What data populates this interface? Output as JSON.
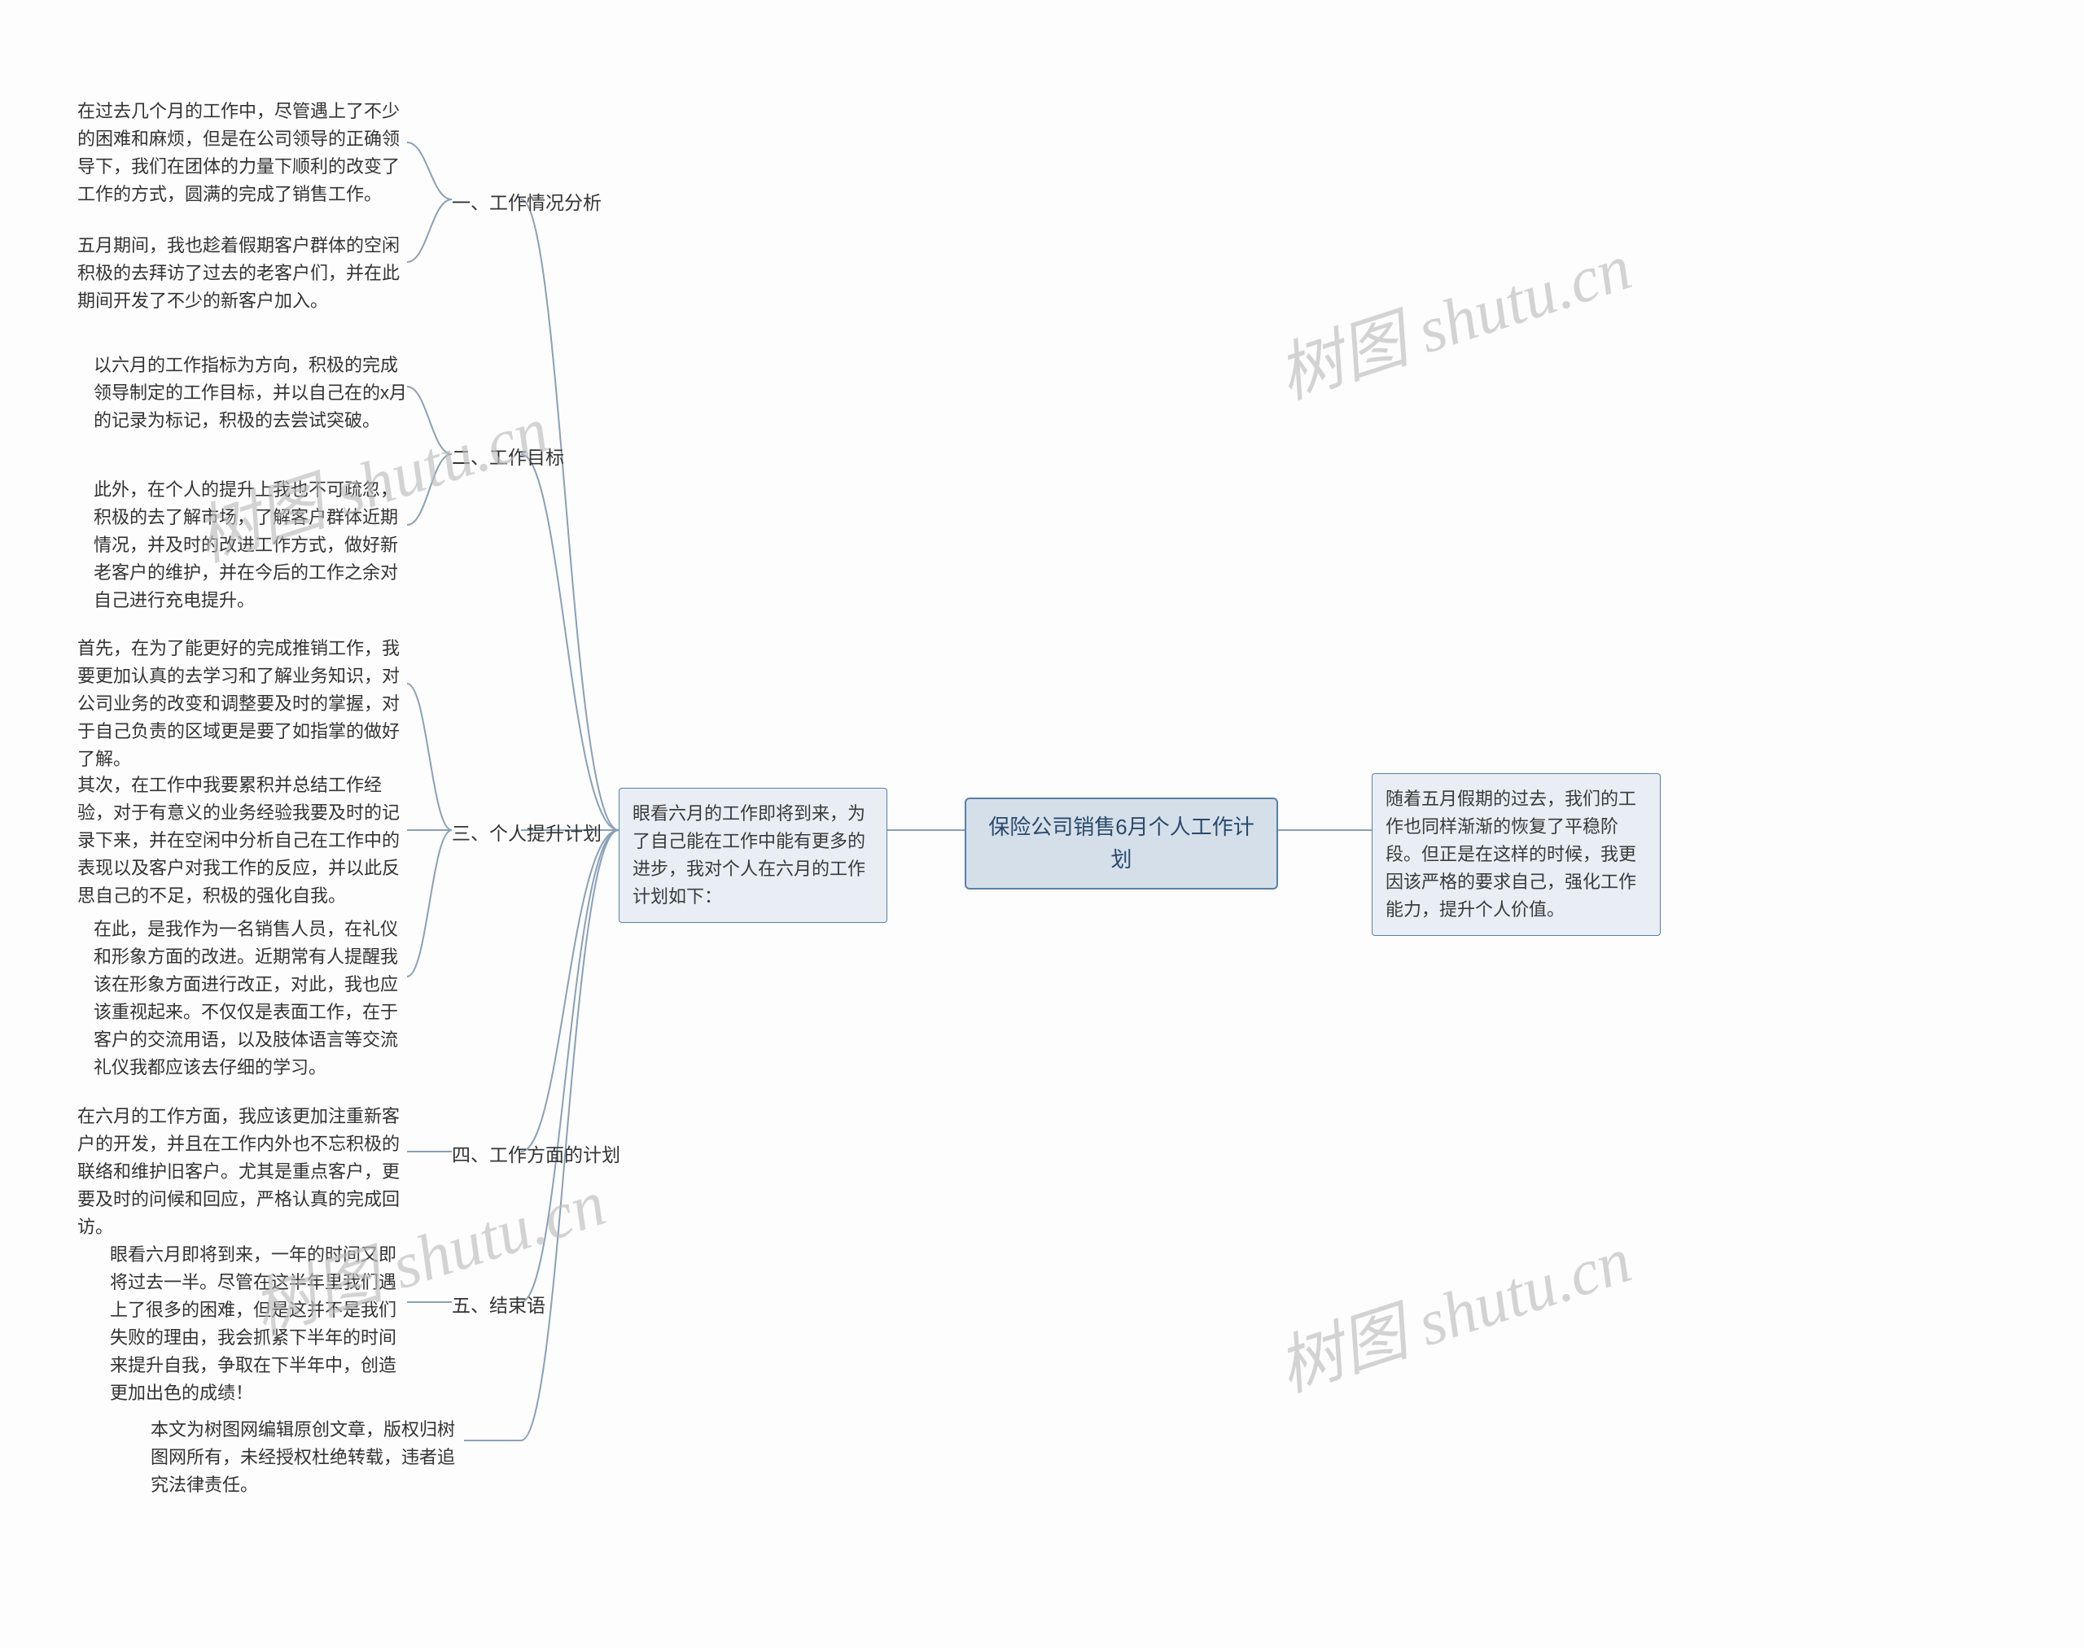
{
  "root": {
    "title": "保险公司销售6月个人工作计划"
  },
  "intro_left": "眼看六月的工作即将到来，为了自己能在工作中能有更多的进步，我对个人在六月的工作计划如下：",
  "intro_right": "随着五月假期的过去，我们的工作也同样渐渐的恢复了平稳阶段。但正是在这样的时候，我更因该严格的要求自己，强化工作能力，提升个人价值。",
  "branches": {
    "b1": {
      "label": "一、工作情况分析",
      "leaves": [
        "在过去几个月的工作中，尽管遇上了不少的困难和麻烦，但是在公司领导的正确领导下，我们在团体的力量下顺利的改变了工作的方式，圆满的完成了销售工作。",
        "五月期间，我也趁着假期客户群体的空闲积极的去拜访了过去的老客户们，并在此期间开发了不少的新客户加入。"
      ]
    },
    "b2": {
      "label": "二、工作目标",
      "leaves": [
        "以六月的工作指标为方向，积极的完成领导制定的工作目标，并以自己在的x月的记录为标记，积极的去尝试突破。",
        "此外，在个人的提升上我也不可疏忽，积极的去了解市场，了解客户群体近期情况，并及时的改进工作方式，做好新老客户的维护，并在今后的工作之余对自己进行充电提升。"
      ]
    },
    "b3": {
      "label": "三、个人提升计划",
      "leaves": [
        "首先，在为了能更好的完成推销工作，我要更加认真的去学习和了解业务知识，对公司业务的改变和调整要及时的掌握，对于自己负责的区域更是要了如指掌的做好了解。",
        "其次，在工作中我要累积并总结工作经验，对于有意义的业务经验我要及时的记录下来，并在空闲中分析自己在工作中的表现以及客户对我工作的反应，并以此反思自己的不足，积极的强化自我。",
        "在此，是我作为一名销售人员，在礼仪和形象方面的改进。近期常有人提醒我该在形象方面进行改正，对此，我也应该重视起来。不仅仅是表面工作，在于客户的交流用语，以及肢体语言等交流礼仪我都应该去仔细的学习。"
      ]
    },
    "b4": {
      "label": "四、工作方面的计划",
      "leaves": [
        "在六月的工作方面，我应该更加注重新客户的开发，并且在工作内外也不忘积极的联络和维护旧客户。尤其是重点客户，更要及时的问候和回应，严格认真的完成回访。"
      ]
    },
    "b5": {
      "label": "五、结束语",
      "leaves": [
        "眼看六月即将到来，一年的时间又即将过去一半。尽管在这半年里我们遇上了很多的困难，但是这并不是我们失败的理由，我会抓紧下半年的时间来提升自我，争取在下半年中，创造更加出色的成绩！"
      ]
    },
    "b6": {
      "label": "",
      "leaves": [
        "本文为树图网编辑原创文章，版权归树图网所有，未经授权杜绝转载，违者追究法律责任。"
      ]
    }
  },
  "watermark": "树图 shutu.cn"
}
